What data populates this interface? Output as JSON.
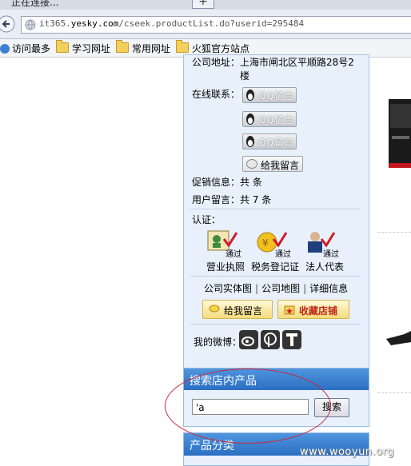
{
  "browser": {
    "tab_title": "正在连接...",
    "new_tab": "+",
    "url_prefix": "it365.",
    "url_domain": "yesky.com",
    "url_path": "/cseek.productList.do?userid=295484"
  },
  "bookmarks": [
    {
      "label": "访问最多"
    },
    {
      "label": "学习网址"
    },
    {
      "label": "常用网址"
    },
    {
      "label": "火狐官方站点"
    }
  ],
  "company": {
    "address_label": "公司地址：",
    "address_value": "上海市闸北区平顺路28号2",
    "address_cont": "楼",
    "contact_label": "在线联系：",
    "qq_button_label": "QQ留言",
    "leave_msg_label": "给我留言",
    "promo_label": "促销信息：",
    "promo_value": "共 条",
    "user_msg_label": "用户留言：",
    "user_msg_value": "共 7 条",
    "cert_label": "认证：",
    "certs": [
      {
        "name": "营业执照",
        "badge": "通过"
      },
      {
        "name": "税务登记证",
        "badge": "通过"
      },
      {
        "name": "法人代表",
        "badge": "通过"
      }
    ],
    "links": [
      "公司实体图",
      "公司地图",
      "详细信息"
    ],
    "leave_msg_button": "给我留言",
    "favorite_button": "收藏店铺",
    "weibo_label": "我的微博："
  },
  "search": {
    "title": "搜索店内产品",
    "input_value": "'a",
    "button": "搜索"
  },
  "category": {
    "title": "产品分类"
  },
  "watermark": "www.wooyun.org",
  "colors": {
    "panel_bg": "#e8f0fb",
    "header_blue": "#2b6fc3",
    "ellipse_red": "#c8283a"
  }
}
